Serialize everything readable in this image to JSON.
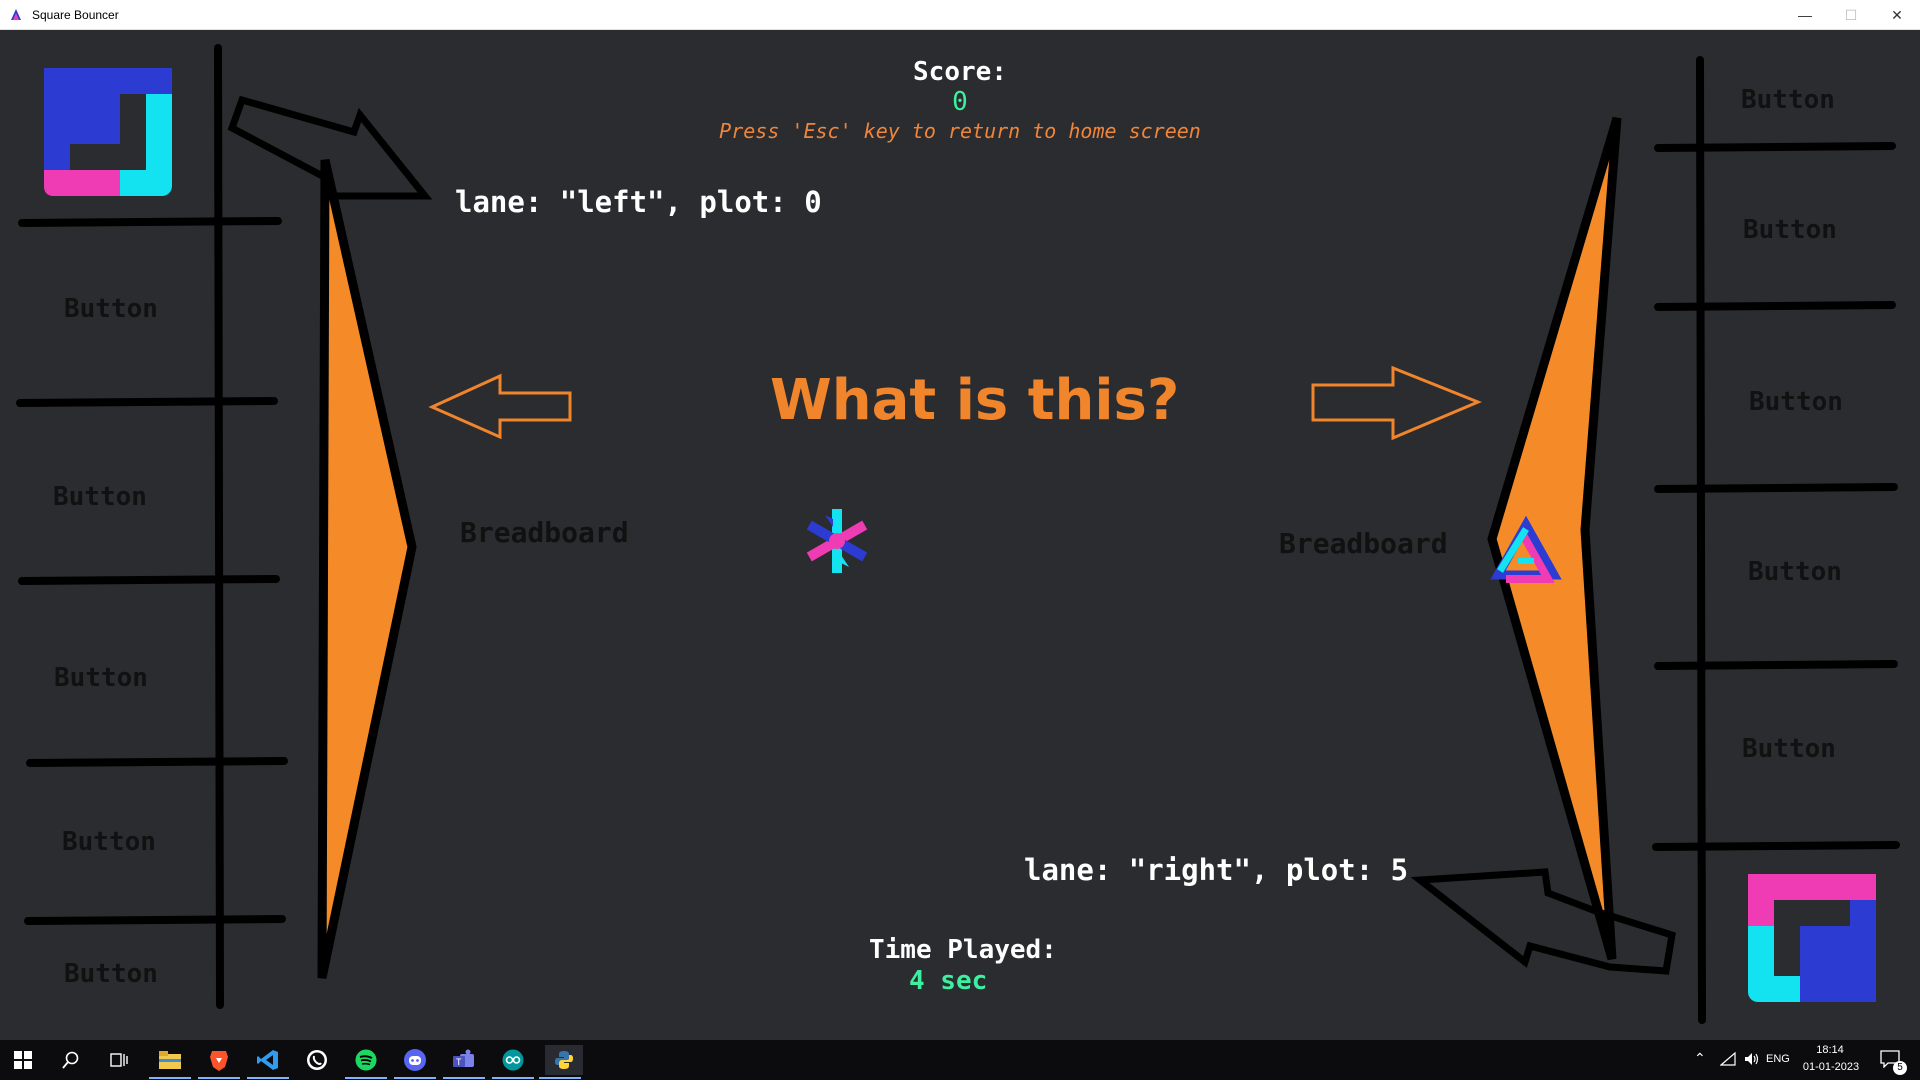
{
  "window": {
    "title": "Square Bouncer",
    "minimize_symbol": "—",
    "maximize_symbol": "☐",
    "close_symbol": "✕"
  },
  "hud": {
    "score_label": "Score:",
    "score_value": "0",
    "hint": "Press 'Esc' key to return to home screen",
    "question": "What is this?",
    "time_label": "Time Played:",
    "time_value": "4 sec"
  },
  "lanes": {
    "left_info": "lane: \"left\", plot: 0",
    "right_info": "lane: \"right\", plot: 5",
    "left_breadboard": "Breadboard",
    "right_breadboard": "Breadboard",
    "left_buttons": [
      "Button",
      "Button",
      "Button",
      "Button",
      "Button"
    ],
    "right_buttons": [
      "Button",
      "Button",
      "Button",
      "Button",
      "Button"
    ]
  },
  "colors": {
    "background": "#2b2c2f",
    "accent_orange": "#f0852c",
    "value_green": "#3cf0a0",
    "logo_cyan": "#13e2f0",
    "logo_blue": "#2c3bd1",
    "logo_pink": "#f03cb4"
  },
  "taskbar": {
    "icons": [
      "windows-start-icon",
      "search-icon",
      "task-view-icon",
      "file-explorer-icon",
      "brave-icon",
      "vscode-icon",
      "whatsapp-icon",
      "spotify-icon",
      "discord-icon",
      "teams-icon",
      "arduino-icon",
      "python-icon"
    ],
    "language": "ENG",
    "time": "18:14",
    "date": "01-01-2023",
    "notifications": "5"
  }
}
